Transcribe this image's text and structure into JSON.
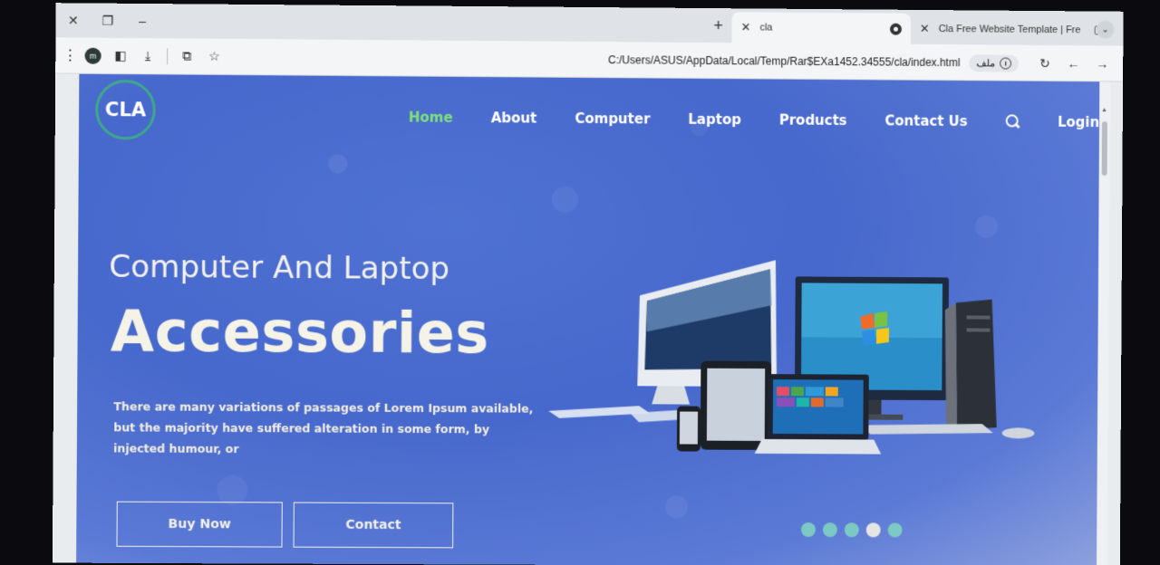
{
  "browser": {
    "active_tab_title": "cla",
    "other_tab_title": "Cla Free Website Template | Fre",
    "address": "C:/Users/ASUS/AppData/Local/Temp/Rar$EXa1452.34555/cla/index.html",
    "file_chip_label": "ملف",
    "profile_initial": "m"
  },
  "site": {
    "logo_text": "CLA",
    "nav": [
      "Home",
      "About",
      "Computer",
      "Laptop",
      "Products",
      "Contact Us"
    ],
    "login_label": "Login",
    "hero": {
      "subtitle": "Computer And Laptop",
      "title": "Accessories",
      "text": "There are many variations of passages of Lorem Ipsum available, but the majority have suffered alteration in some form, by injected humour, or"
    },
    "buttons": {
      "buy": "Buy Now",
      "contact": "Contact"
    },
    "carousel": {
      "count": 5,
      "active_index": 3
    },
    "colors": {
      "accent_green": "#7ee07a",
      "logo_ring": "#3fa88a",
      "hero_bg": "#4768cc",
      "dot": "#7fd0c2"
    }
  }
}
